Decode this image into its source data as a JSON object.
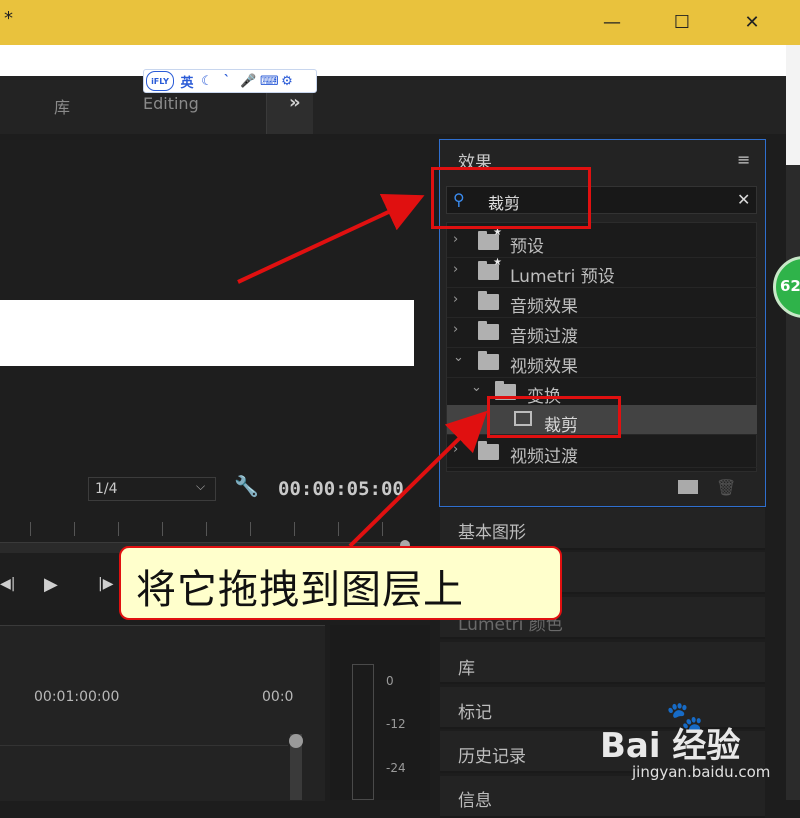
{
  "window": {
    "title_mark": "*",
    "controls": {
      "minimize": "—",
      "maximize": "☐",
      "close": "✕"
    }
  },
  "workspace_tabs": [
    "库",
    "Editing"
  ],
  "workspace_more": "»",
  "ifly_toolbar": {
    "logo": "iFLY",
    "items": [
      "英",
      "☾",
      "ˋ",
      "🎤",
      "⌨",
      "⚙"
    ]
  },
  "monitor": {
    "fraction": "1/4",
    "timecode": "00:00:05:00"
  },
  "timeline": {
    "time_marks": [
      "00:01:00:00",
      "00:0"
    ]
  },
  "meter": {
    "labels": [
      "0",
      "-12",
      "-24"
    ]
  },
  "effects_panel": {
    "title": "效果",
    "menu_icon": "≡",
    "search_value": "裁剪",
    "clear_icon": "✕",
    "tree": [
      {
        "label": "预设",
        "expanded": false
      },
      {
        "label": "Lumetri 预设",
        "expanded": false
      },
      {
        "label": "音频效果",
        "expanded": false
      },
      {
        "label": "音频过渡",
        "expanded": false
      },
      {
        "label": "视频效果",
        "expanded": true
      },
      {
        "label": "变换",
        "expanded": true
      },
      {
        "label": "裁剪",
        "selected": true
      },
      {
        "label": "视频过渡",
        "expanded": false
      }
    ]
  },
  "lower_panels": [
    "基本图形",
    "Lumetri 颜色",
    "库",
    "标记",
    "历史记录",
    "信息"
  ],
  "annotation": {
    "callout_text": "将它拖拽到图层上",
    "accent_color": "#e01010"
  },
  "badge": {
    "text": "62"
  },
  "watermark": {
    "logo": "Bai 经验",
    "sub": "jingyan.baidu.com"
  }
}
